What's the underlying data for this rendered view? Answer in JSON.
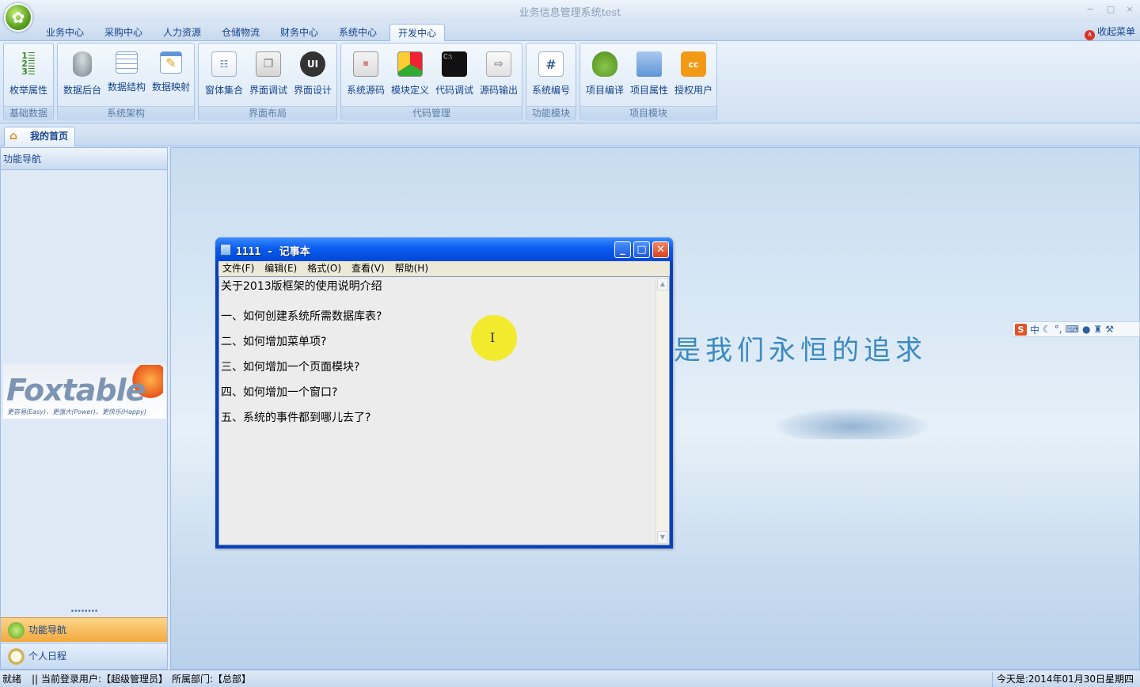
{
  "window": {
    "title": "业务信息管理系统test",
    "min": "−",
    "max": "□",
    "close": "×"
  },
  "menu_tabs": [
    {
      "label": "业务中心"
    },
    {
      "label": "采购中心"
    },
    {
      "label": "人力资源"
    },
    {
      "label": "仓储物流"
    },
    {
      "label": "财务中心"
    },
    {
      "label": "系统中心"
    },
    {
      "label": "开发中心",
      "active": true
    }
  ],
  "collapse_menu": {
    "label": "收起菜单",
    "icon": "collapse-up-icon"
  },
  "ribbon": {
    "groups": [
      {
        "label": "基础数据",
        "buttons": [
          {
            "label": "枚举属性",
            "icon": "numbered-list-icon"
          }
        ]
      },
      {
        "label": "系统架构",
        "buttons": [
          {
            "label": "数据后台",
            "icon": "database-icon"
          },
          {
            "label": "数据结构",
            "icon": "table-grid-icon"
          },
          {
            "label": "数据映射",
            "icon": "mapping-icon"
          }
        ]
      },
      {
        "label": "界面布局",
        "buttons": [
          {
            "label": "窗体集合",
            "icon": "form-icon"
          },
          {
            "label": "界面调试",
            "icon": "windows-icon"
          },
          {
            "label": "界面设计",
            "icon": "ui-design-icon",
            "text": "UI"
          }
        ]
      },
      {
        "label": "代码管理",
        "buttons": [
          {
            "label": "系统源码",
            "icon": "source-code-icon"
          },
          {
            "label": "模块定义",
            "icon": "modules-icon"
          },
          {
            "label": "代码调试",
            "icon": "console-icon",
            "text": "C:\\"
          },
          {
            "label": "源码输出",
            "icon": "export-icon"
          }
        ]
      },
      {
        "label": "功能模块",
        "buttons": [
          {
            "label": "系统编号",
            "icon": "hash-icon",
            "text": "#"
          }
        ]
      },
      {
        "label": "项目模块",
        "buttons": [
          {
            "label": "项目编译",
            "icon": "compile-icon"
          },
          {
            "label": "项目属性",
            "icon": "folder-icon"
          },
          {
            "label": "授权用户",
            "icon": "license-icon",
            "text": "cc"
          }
        ]
      }
    ]
  },
  "doc_tab": {
    "label": "我的首页",
    "icon": "home-icon"
  },
  "sidebar": {
    "header": "功能导航",
    "brand": {
      "name": "Foxtable",
      "tagline": "更容易(Easy)、更强大(Power)、更快乐(Happy)"
    },
    "bottom_buttons": [
      {
        "label": "功能导航",
        "icon": "flower-icon"
      },
      {
        "label": "个人日程",
        "icon": "clock-icon"
      }
    ]
  },
  "main": {
    "slogan": "是我们永恒的追求"
  },
  "ime": {
    "mode": "中",
    "icons": [
      "moon-icon",
      "punct-icon",
      "keyboard-icon",
      "user-icon",
      "shirt-icon",
      "wrench-icon"
    ]
  },
  "notepad": {
    "title": "1111 - 记事本",
    "menu": [
      "文件(F)",
      "编辑(E)",
      "格式(O)",
      "查看(V)",
      "帮助(H)"
    ],
    "lines": [
      "关于2013版框架的使用说明介绍",
      "一、如何创建系统所需数据库表?",
      "二、如何增加菜单项?",
      "三、如何增加一个页面模块?",
      "四、如何增加一个窗口?",
      "五、系统的事件都到哪儿去了?"
    ]
  },
  "statusbar": {
    "ready": "就绪",
    "user": "|| 当前登录用户:【超级管理员】",
    "dept": "所属部门:【总部】",
    "date": "今天是:2014年01月30日星期四"
  },
  "colors": {
    "ribbon_blue": "#15428b",
    "active_nav": "#f3a93d",
    "notepad_title": "#0b5cf0",
    "cursor_highlight": "#f2ea1c"
  }
}
